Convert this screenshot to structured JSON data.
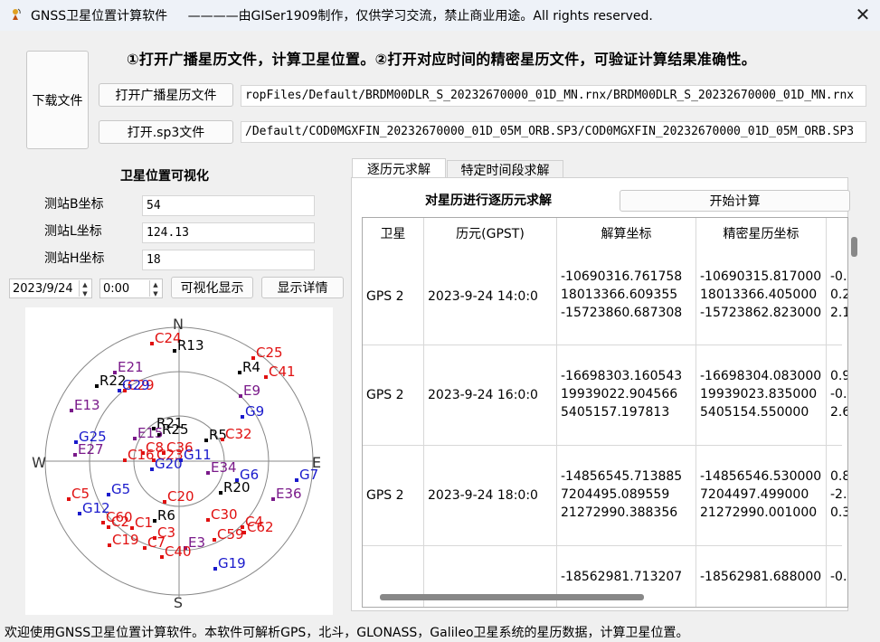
{
  "window": {
    "title": "GNSS卫星位置计算软件",
    "subtitle": "————由GISer1909制作，仅供学习交流，禁止商业用途。All rights reserved.",
    "close_icon": "close-icon",
    "app_icon": "satellite-dish-icon"
  },
  "instructions": "①打开广播星历文件，计算卫星位置。②打开对应时间的精密星历文件，可验证计算结果准确性。",
  "files": {
    "download_label": "下载文件",
    "open_broadcast_label": "打开广播星历文件",
    "broadcast_path": "ropFiles/Default/BRDM00DLR_S_20232670000_01D_MN.rnx/BRDM00DLR_S_20232670000_01D_MN.rnx",
    "open_sp3_label": "打开.sp3文件",
    "sp3_path": "/Default/COD0MGXFIN_20232670000_01D_05M_ORB.SP3/COD0MGXFIN_20232670000_01D_05M_ORB.SP3"
  },
  "visual": {
    "title": "卫星位置可视化",
    "b_label": "测站B坐标",
    "b_value": "54",
    "l_label": "测站L坐标",
    "l_value": "124.13",
    "h_label": "测站H坐标",
    "h_value": "18",
    "date": "2023/9/24",
    "time": "0:00",
    "show_button": "可视化显示",
    "detail_button": "显示详情"
  },
  "skyplot": {
    "directions": {
      "n": "N",
      "s": "S",
      "e": "E",
      "w": "W"
    },
    "colors": {
      "gps": "#1a1acc",
      "bds": "#e01010",
      "glonass": "#000000",
      "galileo": "#7a1a8a"
    },
    "satellites": [
      {
        "label": "C24",
        "sys": "bds"
      },
      {
        "label": "R13",
        "sys": "glonass"
      },
      {
        "label": "C25",
        "sys": "bds"
      },
      {
        "label": "R4",
        "sys": "glonass"
      },
      {
        "label": "C41",
        "sys": "bds"
      },
      {
        "label": "E21",
        "sys": "galileo"
      },
      {
        "label": "R22",
        "sys": "glonass"
      },
      {
        "label": "C29",
        "sys": "bds"
      },
      {
        "label": "G29",
        "sys": "gps"
      },
      {
        "label": "E9",
        "sys": "galileo"
      },
      {
        "label": "E13",
        "sys": "galileo"
      },
      {
        "label": "G9",
        "sys": "gps"
      },
      {
        "label": "R21",
        "sys": "glonass"
      },
      {
        "label": "R25",
        "sys": "glonass"
      },
      {
        "label": "E15",
        "sys": "galileo"
      },
      {
        "label": "R5",
        "sys": "glonass"
      },
      {
        "label": "C32",
        "sys": "bds"
      },
      {
        "label": "G25",
        "sys": "gps"
      },
      {
        "label": "E27",
        "sys": "galileo"
      },
      {
        "label": "C8",
        "sys": "bds"
      },
      {
        "label": "C36",
        "sys": "bds"
      },
      {
        "label": "C16",
        "sys": "bds"
      },
      {
        "label": "C23",
        "sys": "bds"
      },
      {
        "label": "G11",
        "sys": "gps"
      },
      {
        "label": "G20",
        "sys": "gps"
      },
      {
        "label": "E34",
        "sys": "galileo"
      },
      {
        "label": "G6",
        "sys": "gps"
      },
      {
        "label": "G7",
        "sys": "gps"
      },
      {
        "label": "R20",
        "sys": "glonass"
      },
      {
        "label": "E36",
        "sys": "galileo"
      },
      {
        "label": "G5",
        "sys": "gps"
      },
      {
        "label": "C5",
        "sys": "bds"
      },
      {
        "label": "C20",
        "sys": "bds"
      },
      {
        "label": "G12",
        "sys": "gps"
      },
      {
        "label": "C60",
        "sys": "bds"
      },
      {
        "label": "C2",
        "sys": "bds"
      },
      {
        "label": "C1",
        "sys": "bds"
      },
      {
        "label": "R6",
        "sys": "glonass"
      },
      {
        "label": "C30",
        "sys": "bds"
      },
      {
        "label": "C4",
        "sys": "bds"
      },
      {
        "label": "C3",
        "sys": "bds"
      },
      {
        "label": "C59",
        "sys": "bds"
      },
      {
        "label": "C62",
        "sys": "bds"
      },
      {
        "label": "C19",
        "sys": "bds"
      },
      {
        "label": "C7",
        "sys": "bds"
      },
      {
        "label": "E3",
        "sys": "galileo"
      },
      {
        "label": "C40",
        "sys": "bds"
      },
      {
        "label": "G19",
        "sys": "gps"
      }
    ]
  },
  "tabs": [
    {
      "label": "逐历元求解",
      "active": true
    },
    {
      "label": "特定时间段求解",
      "active": false
    }
  ],
  "solve": {
    "heading": "对星历进行逐历元求解",
    "start_button": "开始计算"
  },
  "table": {
    "headers": [
      "卫星",
      "历元(GPST)",
      "解算坐标",
      "精密星历坐标",
      ""
    ],
    "rows": [
      {
        "sat": "GPS 2",
        "epoch": "2023-9-24 14:0:0",
        "calc": [
          "-10690316.761758",
          "18013366.609355",
          "-15723860.687308"
        ],
        "precise": [
          "-10690315.817000",
          "18013366.405000",
          "-15723862.823000"
        ],
        "diff": [
          "-0.",
          "0.2",
          "2.1"
        ]
      },
      {
        "sat": "GPS 2",
        "epoch": "2023-9-24 16:0:0",
        "calc": [
          "-16698303.160543",
          "19939022.904566",
          "5405157.197813"
        ],
        "precise": [
          "-16698304.083000",
          "19939023.835000",
          "5405154.550000"
        ],
        "diff": [
          "0.9",
          "-0.",
          "2.6"
        ]
      },
      {
        "sat": "GPS 2",
        "epoch": "2023-9-24 18:0:0",
        "calc": [
          "-14856545.713885",
          "7204495.089559",
          "21272990.388356"
        ],
        "precise": [
          "-14856546.530000",
          "7204497.499000",
          "21272990.001000"
        ],
        "diff": [
          "0.8",
          "-2.",
          "0.3"
        ]
      },
      {
        "sat": "",
        "epoch": "",
        "calc": [
          "-18562981.713207",
          "",
          ""
        ],
        "precise": [
          "-18562981.688000",
          "",
          ""
        ],
        "diff": [
          "-0.",
          "",
          ""
        ]
      }
    ]
  },
  "status": "欢迎使用GNSS卫星位置计算软件。本软件可解析GPS，北斗，GLONASS，Galileo卫星系统的星历数据，计算卫星位置。"
}
